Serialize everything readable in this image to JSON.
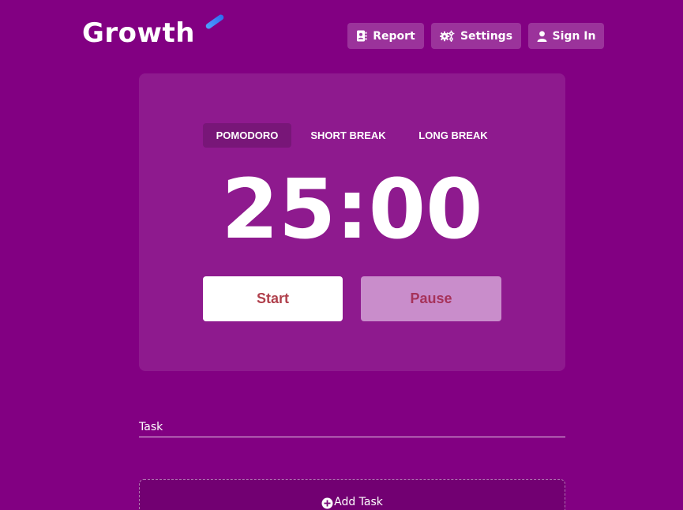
{
  "header": {
    "logo_text": "Growth",
    "nav": {
      "report_label": "Report",
      "settings_label": "Settings",
      "signin_label": "Sign In"
    }
  },
  "timer_card": {
    "tabs": [
      {
        "label": "POMODORO",
        "active": true
      },
      {
        "label": "SHORT BREAK",
        "active": false
      },
      {
        "label": "LONG BREAK",
        "active": false
      }
    ],
    "time": "25:00",
    "start_label": "Start",
    "pause_label": "Pause"
  },
  "tasks": {
    "label": "Task",
    "add_label": "Add Task"
  },
  "colors": {
    "background": "#820082",
    "start_text": "#b0404c",
    "pause_bg": "#c98dcb",
    "logo_accent": "#2d6cf0"
  },
  "icons": {
    "report": "address-book-icon",
    "settings": "gears-icon",
    "signin": "user-icon",
    "add": "plus-circle-icon"
  }
}
